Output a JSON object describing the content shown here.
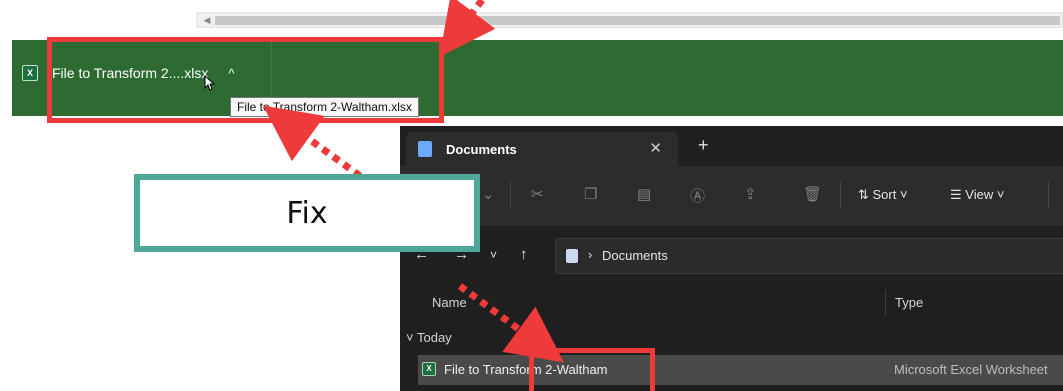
{
  "download_bar": {
    "file_short": "File to Transform 2....xlsx",
    "tooltip": "File to Transform 2-Waltham.xlsx",
    "file_icon": "excel-file-icon",
    "chevron_icon": "chevron-up-icon",
    "accent_color": "#2e6b32"
  },
  "explorer": {
    "tab_title": "Documents",
    "toolbar": {
      "sort_label": "Sort",
      "view_label": "View"
    },
    "path": {
      "folder": "Documents"
    },
    "columns": {
      "name": "Name",
      "type": "Type"
    },
    "group_label": "Today",
    "file": {
      "name": "File to Transform 2-Waltham",
      "type": "Microsoft Excel Worksheet"
    }
  },
  "annotation": {
    "callout_text": "Fix",
    "highlight_color": "#ee3a3a",
    "callout_border_color": "#4fa798"
  }
}
